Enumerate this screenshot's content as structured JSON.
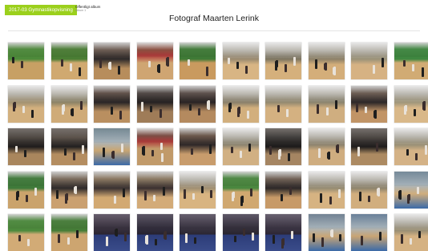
{
  "header": {
    "album_tag": "2017-03 Gymnastikopvisning",
    "album_type": "Offentligt album",
    "album_sub": "Album 1"
  },
  "title": "Fotograf Maarten Lerink",
  "gallery": {
    "rows": 5,
    "columns": 10,
    "photos": [
      {
        "scene": "hall-green",
        "colors": [
          "#4d8a3a",
          "#c7a064",
          "#3a3a45"
        ]
      },
      {
        "scene": "hall-green",
        "colors": [
          "#4a7d34",
          "#d0a970",
          "#2d2d33"
        ]
      },
      {
        "scene": "crowd",
        "colors": [
          "#6b5a50",
          "#b78d5c",
          "#2e2a2a"
        ]
      },
      {
        "scene": "hall-red",
        "colors": [
          "#8a4a3a",
          "#cfa572",
          "#3b2e2e"
        ]
      },
      {
        "scene": "hall-green",
        "colors": [
          "#3f7a36",
          "#c99a5f",
          "#2f2f36"
        ]
      },
      {
        "scene": "hall-bright",
        "colors": [
          "#9a8a70",
          "#d8b584",
          "#4a4040"
        ]
      },
      {
        "scene": "hall-bright",
        "colors": [
          "#7c7460",
          "#d5b07c",
          "#443838"
        ]
      },
      {
        "scene": "hall-bright",
        "colors": [
          "#8d8168",
          "#d4ae7a",
          "#4a3f3f"
        ]
      },
      {
        "scene": "hall-bright",
        "colors": [
          "#9a9178",
          "#d6b283",
          "#3c3434"
        ]
      },
      {
        "scene": "hall-green",
        "colors": [
          "#3f8740",
          "#d1ab74",
          "#383838"
        ]
      },
      {
        "scene": "hall-bright",
        "colors": [
          "#a39272",
          "#d3b07e",
          "#3a3030"
        ]
      },
      {
        "scene": "hall-bright",
        "colors": [
          "#8c8366",
          "#cfab78",
          "#3e3535"
        ]
      },
      {
        "scene": "crowd",
        "colors": [
          "#5e4e46",
          "#b98f60",
          "#2a2626"
        ]
      },
      {
        "scene": "crowd",
        "colors": [
          "#4e4542",
          "#9f7c58",
          "#262222"
        ]
      },
      {
        "scene": "crowd",
        "colors": [
          "#5a4d48",
          "#b48a5f",
          "#2a2424"
        ]
      },
      {
        "scene": "hall-bright",
        "colors": [
          "#8a806a",
          "#d2af7d",
          "#3a3232"
        ]
      },
      {
        "scene": "hall-bright",
        "colors": [
          "#938970",
          "#d4b181",
          "#363030"
        ]
      },
      {
        "scene": "hall-bright",
        "colors": [
          "#8b846e",
          "#cfae80",
          "#3a3434"
        ]
      },
      {
        "scene": "crowd",
        "colors": [
          "#6a5a50",
          "#c19466",
          "#2d2828"
        ]
      },
      {
        "scene": "hall-bright",
        "colors": [
          "#a0967b",
          "#d9b889",
          "#463c3c"
        ]
      },
      {
        "scene": "hall-dark",
        "colors": [
          "#4d4640",
          "#a9865d",
          "#1f1c1c"
        ]
      },
      {
        "scene": "hall-dark",
        "colors": [
          "#5a5048",
          "#b48d60",
          "#222020"
        ]
      },
      {
        "scene": "hall-blue",
        "colors": [
          "#6a7f8a",
          "#c9a673",
          "#2c2c2c"
        ]
      },
      {
        "scene": "hall-red",
        "colors": [
          "#7a4a40",
          "#c19a6a",
          "#2a2424"
        ]
      },
      {
        "scene": "crowd",
        "colors": [
          "#6a5548",
          "#c89c6c",
          "#2e2828"
        ]
      },
      {
        "scene": "hall-bright",
        "colors": [
          "#8d8570",
          "#d1b083",
          "#3a3434"
        ]
      },
      {
        "scene": "hall-dark",
        "colors": [
          "#3d3a38",
          "#a58562",
          "#1c1a1a"
        ]
      },
      {
        "scene": "hall-bright",
        "colors": [
          "#8e846e",
          "#cfad80",
          "#363030"
        ]
      },
      {
        "scene": "hall-dark",
        "colors": [
          "#4a4440",
          "#ac8a62",
          "#1e1c1c"
        ]
      },
      {
        "scene": "hall-bright",
        "colors": [
          "#9a9076",
          "#d4b286",
          "#3e3636"
        ]
      },
      {
        "scene": "hall-green",
        "colors": [
          "#3f7a3a",
          "#caa36c",
          "#2e2e33"
        ]
      },
      {
        "scene": "crowd",
        "colors": [
          "#7a6a5a",
          "#caa070",
          "#2e2a2a"
        ]
      },
      {
        "scene": "crowd",
        "colors": [
          "#8a765e",
          "#d2a972",
          "#3a3232"
        ]
      },
      {
        "scene": "crowd",
        "colors": [
          "#8c7a62",
          "#d3ab78",
          "#3a3030"
        ]
      },
      {
        "scene": "hall-bright",
        "colors": [
          "#a08f72",
          "#d8b481",
          "#463a3a"
        ]
      },
      {
        "scene": "hall-green",
        "colors": [
          "#4a873f",
          "#d0a870",
          "#3a2e2e"
        ]
      },
      {
        "scene": "crowd",
        "colors": [
          "#6e5e52",
          "#c79a68",
          "#2c2828"
        ]
      },
      {
        "scene": "hall-bright",
        "colors": [
          "#958b72",
          "#d6b382",
          "#3c3434"
        ]
      },
      {
        "scene": "hall-bright",
        "colors": [
          "#8e846c",
          "#d1ae7e",
          "#383232"
        ]
      },
      {
        "scene": "hall-blue",
        "colors": [
          "#6a8090",
          "#cfad7c",
          "#2e2e2e"
        ]
      },
      {
        "scene": "hall-green",
        "colors": [
          "#4d8a3d",
          "#d2ab76",
          "#333333"
        ]
      },
      {
        "scene": "hall-green",
        "colors": [
          "#467d38",
          "#cda570",
          "#2e2e2e"
        ]
      },
      {
        "scene": "stage",
        "colors": [
          "#5a5060",
          "#b48a60",
          "#2a2430"
        ]
      },
      {
        "scene": "stage",
        "colors": [
          "#4e4858",
          "#a9825a",
          "#262230"
        ]
      },
      {
        "scene": "stage",
        "colors": [
          "#5a5262",
          "#b38b62",
          "#2a2632"
        ]
      },
      {
        "scene": "stage",
        "colors": [
          "#50495a",
          "#ad875e",
          "#28242e"
        ]
      },
      {
        "scene": "stage",
        "colors": [
          "#5c5464",
          "#b58d64",
          "#2c2634"
        ]
      },
      {
        "scene": "hall-blue",
        "colors": [
          "#66788a",
          "#c9a677",
          "#2c2c30"
        ]
      },
      {
        "scene": "hall-blue",
        "colors": [
          "#5d7690",
          "#c8a474",
          "#2a2a2e"
        ]
      },
      {
        "scene": "hall-bright",
        "colors": [
          "#9a8f74",
          "#d5b283",
          "#3a3232"
        ]
      }
    ]
  }
}
